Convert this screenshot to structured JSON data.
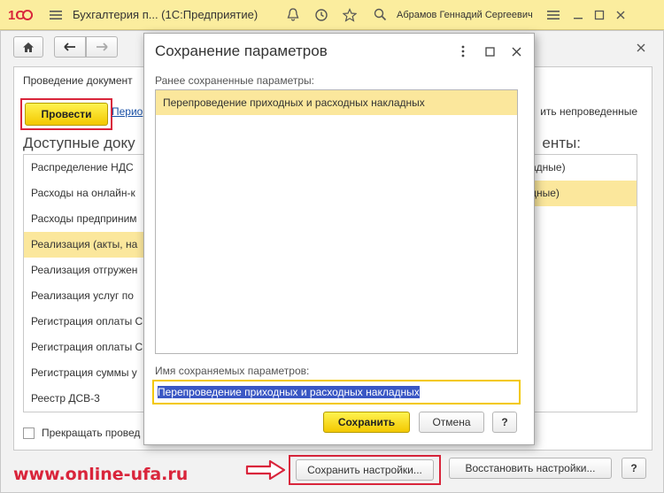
{
  "titlebar": {
    "app_title": "Бухгалтерия п...  (1С:Предприятие)",
    "user_name": "Абрамов Геннадий Сергеевич"
  },
  "form": {
    "tab_title": "Проведение документ",
    "post_button": "Провести",
    "period_link": "Перио",
    "right_text": "ить непроведенные",
    "available_title": "Доступные доку",
    "right_title": "енты:",
    "documents": [
      "Распределение НДС",
      "Расходы на онлайн-к",
      "Расходы предприним",
      "Реализация (акты, на",
      "Реализация отгружен",
      "Реализация услуг по",
      "Регистрация оплаты С",
      "Регистрация оплаты С",
      "Регистрация суммы у",
      "Реестр ДСВ-3"
    ],
    "selected_documents": [
      "адные)",
      "дные)"
    ],
    "stop_checkbox_label": "Прекращать провед"
  },
  "footer": {
    "watermark": "www.online-ufa.ru",
    "save_settings": "Сохранить настройки...",
    "restore_settings": "Восстановить настройки...",
    "help": "?"
  },
  "dialog": {
    "title": "Сохранение параметров",
    "saved_label": "Ранее сохраненные параметры:",
    "saved_items": [
      "Перепроведение приходных и расходных накладных"
    ],
    "name_label": "Имя сохраняемых параметров:",
    "name_value": "Перепроведение приходных и расходных накладных",
    "save_button": "Сохранить",
    "cancel_button": "Отмена",
    "help": "?"
  },
  "colors": {
    "accent_yellow": "#f3c800",
    "selection": "#fbe79c",
    "highlight_red": "#d9253b",
    "titlebar_bg": "#fbed9e"
  }
}
